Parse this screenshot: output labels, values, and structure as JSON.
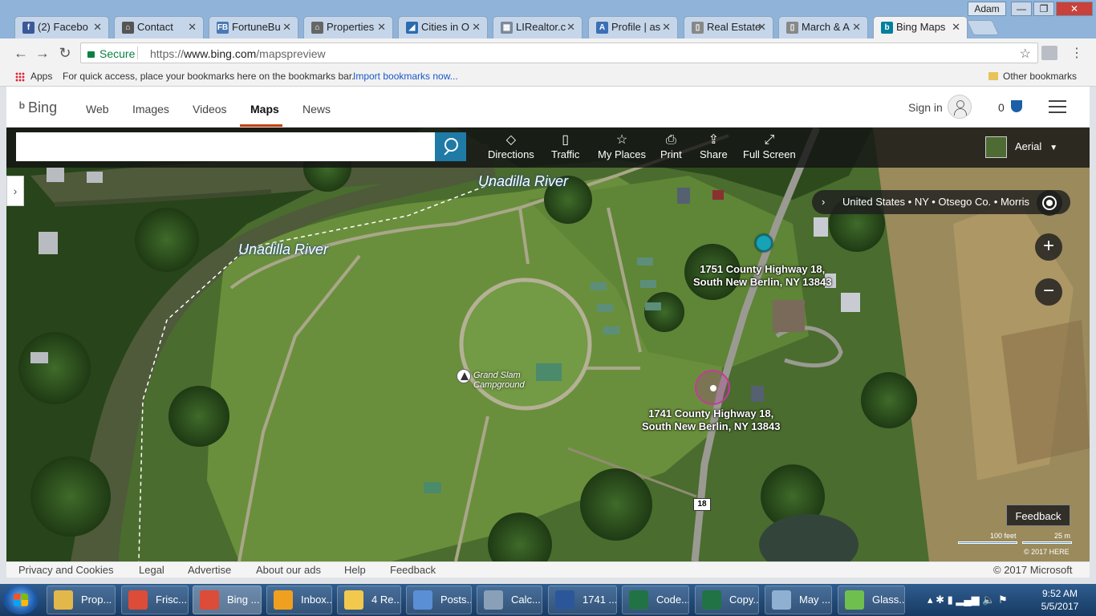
{
  "window": {
    "user": "Adam",
    "minimize": "—",
    "maximize": "❐",
    "close": "✕"
  },
  "tabs": [
    {
      "label": "(2) Facebo",
      "icon_color": "#3b5998",
      "icon_text": "f"
    },
    {
      "label": "Contact",
      "icon_color": "#555555",
      "icon_text": "⌂"
    },
    {
      "label": "FortuneBu",
      "icon_color": "#4a79b5",
      "icon_text": "FB"
    },
    {
      "label": "Properties",
      "icon_color": "#666666",
      "icon_text": "⌂"
    },
    {
      "label": "Cities in O",
      "icon_color": "#2b6cb0",
      "icon_text": "◢"
    },
    {
      "label": "LIRealtor.c",
      "icon_color": "#7a8a9a",
      "icon_text": "▦"
    },
    {
      "label": "Profile | as",
      "icon_color": "#3b6fb6",
      "icon_text": "A"
    },
    {
      "label": "Real Estate",
      "icon_color": "#888888",
      "icon_text": "▯"
    },
    {
      "label": "March & A",
      "icon_color": "#888888",
      "icon_text": "▯"
    },
    {
      "label": "Bing Maps",
      "icon_color": "#00809d",
      "icon_text": "b",
      "active": true
    }
  ],
  "addressbar": {
    "secure_label": "Secure",
    "url_scheme": "https://",
    "url_host": "www.bing.com",
    "url_path": "/mapspreview"
  },
  "bookmarks": {
    "apps": "Apps",
    "hint": "For quick access, place your bookmarks here on the bookmarks bar.",
    "import_link": "Import bookmarks now...",
    "other": "Other bookmarks"
  },
  "bing": {
    "logo": "Bing",
    "scopes": [
      "Web",
      "Images",
      "Videos",
      "Maps",
      "News"
    ],
    "active_scope": "Maps",
    "signin": "Sign in",
    "rewards": "0"
  },
  "map": {
    "search_placeholder": "",
    "toolbar": [
      {
        "label": "Directions",
        "icon": "◇"
      },
      {
        "label": "Traffic",
        "icon": "▯"
      },
      {
        "label": "My Places",
        "icon": "☆"
      },
      {
        "label": "Print",
        "icon": "⎙"
      },
      {
        "label": "Share",
        "icon": "⇪"
      },
      {
        "label": "Full Screen",
        "icon": "⤢"
      }
    ],
    "style": "Aerial",
    "breadcrumb": "United States • NY • Otsego Co. • Morris",
    "river_label_1": "Unadilla River",
    "river_label_2": "Unadilla River",
    "poi_line1": "Grand Slam",
    "poi_line2": "Campground",
    "addr1_line1": "1751 County Highway 18,",
    "addr1_line2": "South New Berlin, NY 13843",
    "addr2_line1": "1741 County Highway 18,",
    "addr2_line2": "South New Berlin, NY 13843",
    "route": "18",
    "feedback": "Feedback",
    "scale_ft": "100 feet",
    "scale_m": "25 m",
    "map_copyright": "© 2017 HERE"
  },
  "footer": {
    "links": [
      "Privacy and Cookies",
      "Legal",
      "Advertise",
      "About our ads",
      "Help",
      "Feedback"
    ],
    "copyright": "© 2017 Microsoft"
  },
  "taskbar": {
    "items": [
      {
        "label": "Prop...",
        "color": "#e2b84a"
      },
      {
        "label": "Frisc...",
        "color": "#dd4b39"
      },
      {
        "label": "Bing ...",
        "color": "#dd4b39",
        "active": true
      },
      {
        "label": "Inbox...",
        "color": "#f0a020"
      },
      {
        "label": "4 Re...",
        "color": "#f2c94c"
      },
      {
        "label": "Posts...",
        "color": "#5a8fd6"
      },
      {
        "label": "Calc...",
        "color": "#8aa0b8"
      },
      {
        "label": "1741 ...",
        "color": "#2b579a"
      },
      {
        "label": "Code...",
        "color": "#217346"
      },
      {
        "label": "Copy...",
        "color": "#217346"
      },
      {
        "label": "May ...",
        "color": "#8fb0d0"
      },
      {
        "label": "Glass...",
        "color": "#6fbf4f"
      }
    ],
    "time": "9:52 AM",
    "date": "5/5/2017"
  }
}
